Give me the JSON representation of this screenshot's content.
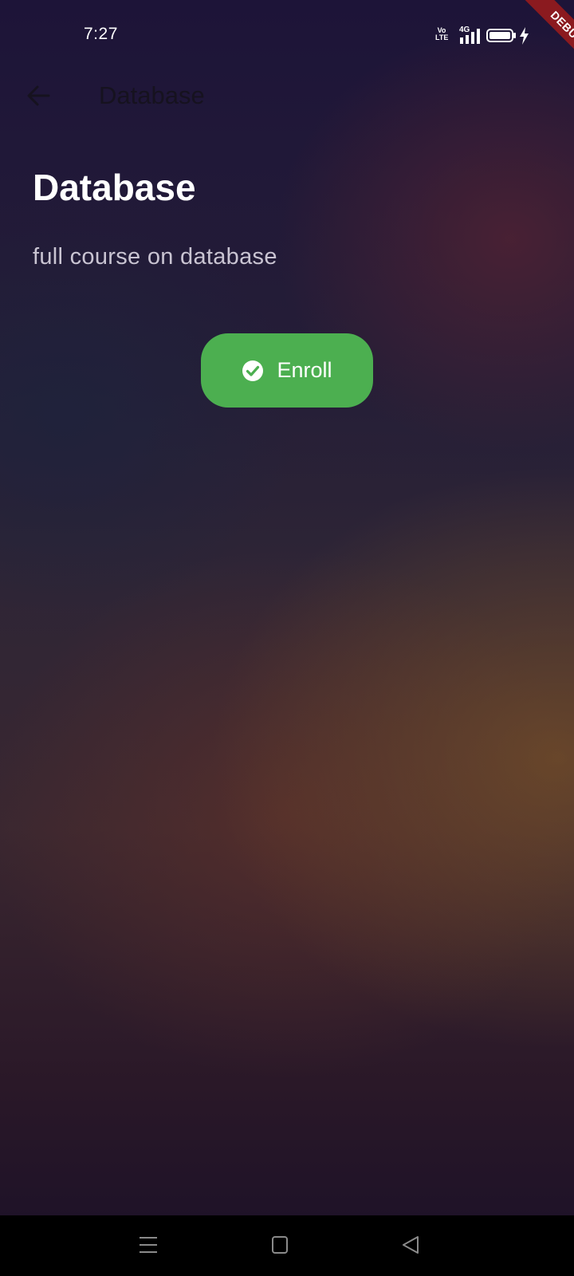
{
  "status_bar": {
    "time": "7:27",
    "network": "4G",
    "volte_top": "Vo",
    "volte_bottom": "LTE"
  },
  "debug_banner": "DEBUG",
  "app_bar": {
    "title": "Database"
  },
  "content": {
    "title": "Database",
    "description": "full course on database"
  },
  "enroll_button": {
    "label": "Enroll",
    "color": "#4caf50"
  },
  "icons": {
    "back": "arrow-left-icon",
    "enroll": "check-circle-icon",
    "nav_menu": "menu-icon",
    "nav_home": "home-square-icon",
    "nav_back": "triangle-back-icon"
  }
}
